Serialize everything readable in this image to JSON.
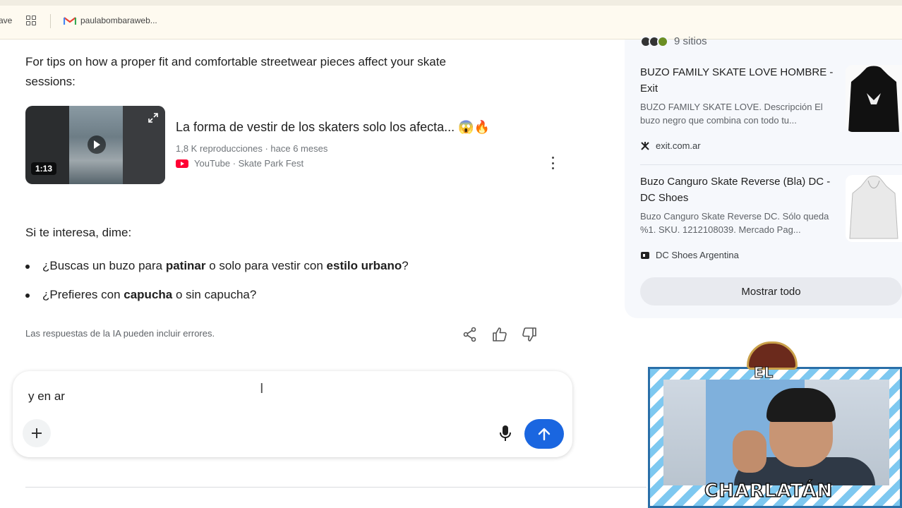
{
  "bookmarks": {
    "left_fragment": "ave",
    "gmail_label": "paulabombaraweb..."
  },
  "answer": {
    "intro": "For tips on how a proper fit and comfortable streetwear pieces affect your skate",
    "intro_line2": "sessions:",
    "video": {
      "title": "La forma de vestir de los skaters solo los afecta... 😱🔥",
      "meta": "1,8 K reproducciones · hace 6 meses",
      "source": "YouTube · Skate Park Fest",
      "duration": "1:13"
    },
    "followup_prompt": "Si te interesa, dime:",
    "bullets": [
      {
        "before": "¿Buscas un buzo para ",
        "bold1": "patinar",
        "middle": " o solo para vestir con ",
        "bold2": "estilo urbano",
        "after": "?"
      },
      {
        "before": "¿Prefieres con ",
        "bold1": "capucha",
        "after": " o sin capucha?"
      }
    ],
    "disclaimer": "Las respuestas de la IA pueden incluir errores."
  },
  "composer": {
    "value": "y en ar"
  },
  "sidebar": {
    "sites_label": "9 sitios",
    "results": [
      {
        "title": "BUZO FAMILY SKATE LOVE HOMBRE - Exit",
        "desc": "BUZO FAMILY SKATE LOVE. Descripción El buzo negro que combina con todo tu...",
        "source": "exit.com.ar"
      },
      {
        "title": "Buzo Canguro Skate Reverse (Bla) DC - DC Shoes",
        "desc": "Buzo Canguro Skate Reverse DC. Sólo queda %1. SKU. 1212108039. Mercado Pag...",
        "source": "DC Shoes Argentina"
      }
    ],
    "show_all": "Mostrar todo"
  },
  "overlay": {
    "top_label": "EL",
    "name_label": "CHARLATÁN"
  },
  "colors": {
    "send_button": "#1a66e0",
    "youtube": "#ff0033",
    "panel_bg": "#f6f8fc"
  },
  "icons": [
    "apps-grid-icon",
    "gmail-icon",
    "play-icon",
    "expand-icon",
    "youtube-icon",
    "more-vert-icon",
    "share-icon",
    "thumbs-up-icon",
    "thumbs-down-icon",
    "plus-icon",
    "mic-icon",
    "send-arrow-icon",
    "exit-favicon",
    "dc-favicon"
  ]
}
